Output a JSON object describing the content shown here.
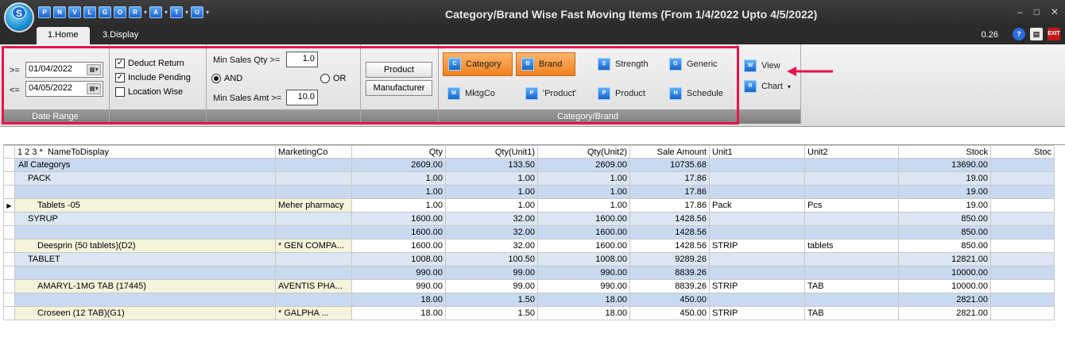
{
  "window": {
    "title": "Category/Brand Wise Fast Moving Items (From 1/4/2022 Upto 4/5/2022)",
    "version": "0.26",
    "logo_letter": "S"
  },
  "quick_access": [
    "P",
    "N",
    "V",
    "L",
    "G",
    "O",
    "R",
    "A",
    "T",
    "U"
  ],
  "tabs": [
    {
      "label": "1.Home",
      "active": true
    },
    {
      "label": "3.Display",
      "active": false
    }
  ],
  "date_range": {
    "label": "Date Range",
    "from_op": ">=",
    "from": "01/04/2022",
    "to_op": "<=",
    "to": "04/05/2022"
  },
  "options": {
    "deduct_return": {
      "label": "Deduct Return",
      "checked": true
    },
    "include_pending": {
      "label": "Include Pending",
      "checked": true
    },
    "location_wise": {
      "label": "Location Wise",
      "checked": false
    }
  },
  "filters": {
    "min_qty_label": "Min Sales Qty >=",
    "min_qty": "1.0",
    "and_label": "AND",
    "or_label": "OR",
    "logic": "AND",
    "min_amt_label": "Min Sales Amt >=",
    "min_amt": "10.0"
  },
  "product_buttons": {
    "product": "Product",
    "manufacturer": "Manufacturer"
  },
  "category_brand": {
    "label": "Category/Brand",
    "buttons": [
      {
        "label": "Category",
        "icon": "category-icon",
        "selected": true
      },
      {
        "label": "Brand",
        "icon": "brand-icon",
        "selected": true
      },
      {
        "label": "Strength",
        "icon": "strength-icon",
        "selected": false
      },
      {
        "label": "Generic",
        "icon": "generic-icon",
        "selected": false
      },
      {
        "label": "MktgCo",
        "icon": "mktgco-icon",
        "selected": false
      },
      {
        "label": "'Product'",
        "icon": "product-quote-icon",
        "selected": false
      },
      {
        "label": "Product",
        "icon": "product-icon",
        "selected": false
      },
      {
        "label": "Schedule",
        "icon": "schedule-icon",
        "selected": false
      }
    ]
  },
  "view": {
    "view_label": "View",
    "chart_label": "Chart"
  },
  "grid": {
    "level_header": "1 2 3 *",
    "columns": [
      "NameToDisplay",
      "MarketingCo",
      "Qty",
      "Qty(Unit1)",
      "Qty(Unit2)",
      "Sale Amount",
      "Unit1",
      "Unit2",
      "Stock",
      "Stoc"
    ],
    "rows": [
      {
        "type": "lvl0",
        "name": "All Categorys",
        "mkt": "",
        "qty": "2609.00",
        "qu1": "133.50",
        "qu2": "2609.00",
        "amt": "10735.68",
        "unit1": "",
        "unit2": "",
        "stock": "13690.00"
      },
      {
        "type": "lvl1",
        "name": "PACK",
        "mkt": "",
        "qty": "1.00",
        "qu1": "1.00",
        "qu2": "1.00",
        "amt": "17.86",
        "unit1": "",
        "unit2": "",
        "stock": "19.00"
      },
      {
        "type": "lvl2",
        "name": "",
        "mkt": "",
        "qty": "1.00",
        "qu1": "1.00",
        "qu2": "1.00",
        "amt": "17.86",
        "unit1": "",
        "unit2": "",
        "stock": "19.00"
      },
      {
        "type": "item",
        "name": "Tablets -05",
        "mkt": "Meher pharmacy",
        "qty": "1.00",
        "qu1": "1.00",
        "qu2": "1.00",
        "amt": "17.86",
        "unit1": "Pack",
        "unit2": "Pcs",
        "stock": "19.00",
        "current": true
      },
      {
        "type": "lvl1",
        "name": "SYRUP",
        "mkt": "",
        "qty": "1600.00",
        "qu1": "32.00",
        "qu2": "1600.00",
        "amt": "1428.56",
        "unit1": "",
        "unit2": "",
        "stock": "850.00"
      },
      {
        "type": "lvl2",
        "name": "",
        "mkt": "",
        "qty": "1600.00",
        "qu1": "32.00",
        "qu2": "1600.00",
        "amt": "1428.56",
        "unit1": "",
        "unit2": "",
        "stock": "850.00"
      },
      {
        "type": "item",
        "name": "Deesprin (50 tablets)(D2)",
        "mkt": "* GEN COMPA...",
        "qty": "1600.00",
        "qu1": "32.00",
        "qu2": "1600.00",
        "amt": "1428.56",
        "unit1": "STRIP",
        "unit2": "tablets",
        "stock": "850.00"
      },
      {
        "type": "lvl1",
        "name": "TABLET",
        "mkt": "",
        "qty": "1008.00",
        "qu1": "100.50",
        "qu2": "1008.00",
        "amt": "9289.26",
        "unit1": "",
        "unit2": "",
        "stock": "12821.00"
      },
      {
        "type": "lvl2",
        "name": "",
        "mkt": "",
        "qty": "990.00",
        "qu1": "99.00",
        "qu2": "990.00",
        "amt": "8839.26",
        "unit1": "",
        "unit2": "",
        "stock": "10000.00"
      },
      {
        "type": "item",
        "name": "AMARYL-1MG TAB                    (17445)",
        "mkt": "AVENTIS PHA...",
        "qty": "990.00",
        "qu1": "99.00",
        "qu2": "990.00",
        "amt": "8839.26",
        "unit1": "STRIP",
        "unit2": "TAB",
        "stock": "10000.00"
      },
      {
        "type": "lvl2",
        "name": "",
        "mkt": "",
        "qty": "18.00",
        "qu1": "1.50",
        "qu2": "18.00",
        "amt": "450.00",
        "unit1": "",
        "unit2": "",
        "stock": "2821.00"
      },
      {
        "type": "item",
        "name": "Croseen (12 TAB)(G1)",
        "mkt": "* GALPHA         ...",
        "qty": "18.00",
        "qu1": "1.50",
        "qu2": "18.00",
        "amt": "450.00",
        "unit1": "STRIP",
        "unit2": "TAB",
        "stock": "2821.00"
      }
    ]
  }
}
